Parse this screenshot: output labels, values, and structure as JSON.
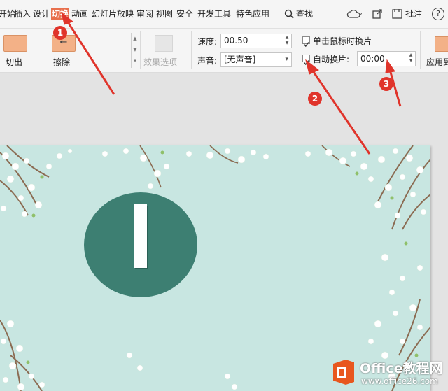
{
  "menu": {
    "tabs": [
      "开始",
      "插入",
      "设计",
      "切换",
      "动画",
      "幻灯片放映",
      "审阅",
      "视图",
      "安全",
      "开发工具",
      "特色应用"
    ],
    "search": "查找",
    "annotate": "批注",
    "help": "?"
  },
  "ribbon": {
    "effect1": "切出",
    "effect2": "擦除",
    "effect_options": "效果选项",
    "speed_label": "速度:",
    "speed_value": "00.50",
    "sound_label": "声音:",
    "sound_value": "[无声音]",
    "click_advance_label": "单击鼠标时换片",
    "click_advance_checked": true,
    "auto_advance_label": "自动换片:",
    "auto_advance_checked": true,
    "auto_advance_value": "00:00",
    "apply_all": "应用到"
  },
  "slide": {
    "big_letter": "I",
    "bg_color": "#c8e6e1",
    "circle_color": "#3d7f72"
  },
  "annotations": {
    "markers": [
      "1",
      "2",
      "3"
    ],
    "color": "#e0342b"
  },
  "watermark": {
    "brand": "Office教程网",
    "url": "www.office26.com"
  }
}
